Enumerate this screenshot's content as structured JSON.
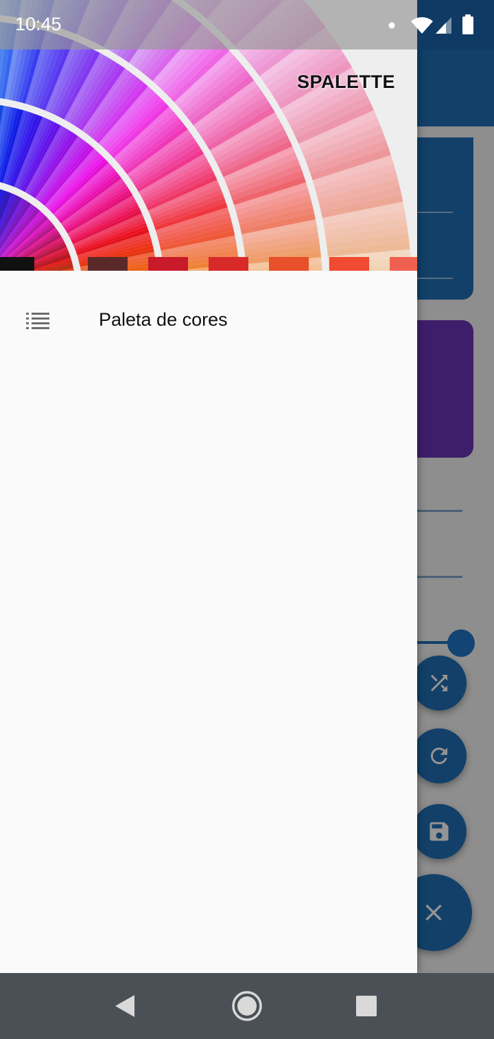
{
  "status_bar": {
    "time": "10:45",
    "icons": [
      "notification-dot-icon",
      "wifi-icon",
      "cell-signal-icon",
      "battery-icon"
    ]
  },
  "drawer": {
    "header": {
      "brand_title": "SPALETTE",
      "image": "color-swatch-fan-image"
    },
    "items": [
      {
        "label": "Paleta de cores",
        "icon": "list-icon"
      }
    ]
  },
  "background_app": {
    "fabs": [
      "shuffle-icon",
      "refresh-icon",
      "save-icon",
      "close-icon"
    ],
    "colors": {
      "primary": "#1f6fb5",
      "card_purple": "#6a35b8"
    }
  },
  "system_nav": {
    "buttons": [
      "back-icon",
      "home-icon",
      "recents-icon"
    ]
  }
}
